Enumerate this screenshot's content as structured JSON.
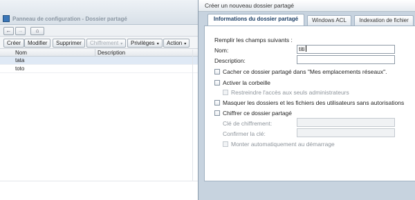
{
  "left_window": {
    "title": "Panneau de configuration - Dossier partagé",
    "nav": {
      "back": "←",
      "forward": "→",
      "home": "⌂"
    },
    "toolbar": {
      "create": "Créer",
      "modify": "Modifier",
      "delete": "Supprimer",
      "encryption": "Chiffrement",
      "privileges": "Privilèges",
      "action": "Action",
      "dropdown_caret": "▾"
    },
    "columns": [
      "Nom",
      "Description"
    ],
    "rows": [
      {
        "name": "tata",
        "description": ""
      },
      {
        "name": "toto",
        "description": ""
      }
    ]
  },
  "dialog": {
    "title": "Créer un nouveau dossier partagé",
    "tabs": [
      "Informations du dossier partagé",
      "Windows ACL",
      "Indexation de fichier"
    ],
    "instruction": "Remplir les champs suivants :",
    "name_label": "Nom:",
    "name_value": "titi",
    "description_label": "Description:",
    "description_value": "",
    "options": {
      "hide_in_network": "Cacher ce dossier partagé dans \"Mes emplacements réseaux\".",
      "recycle_bin": "Activer la corbeille",
      "restrict_admins": "Restreindre l'accès aux seuls administrateurs",
      "hide_unauthorized": "Masquer les dossiers et les fichiers des utilisateurs sans autorisations",
      "encrypt": "Chiffrer ce dossier partagé"
    },
    "encryption_key_label": "Clé de chiffrement:",
    "confirm_key_label": "Confirmer la clé:",
    "auto_mount": "Monter automatiquement au démarrage"
  }
}
